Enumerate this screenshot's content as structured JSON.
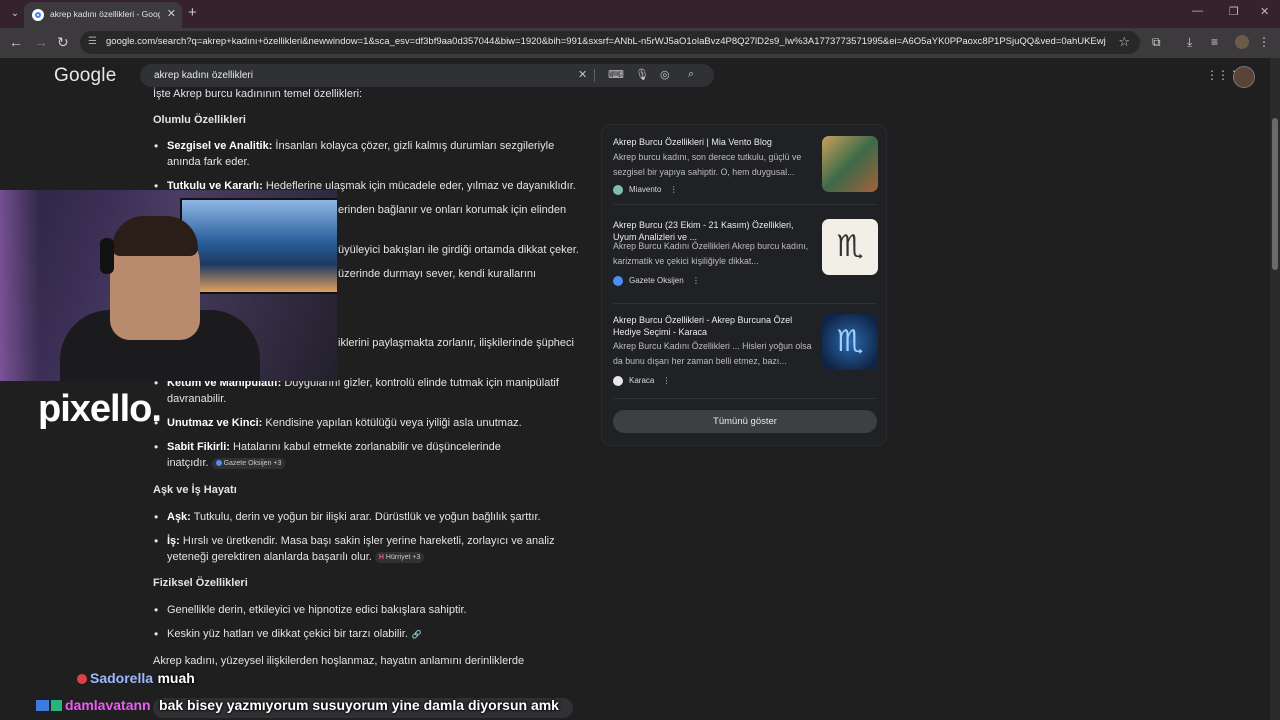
{
  "browser": {
    "tab_title": "akrep kadını özellikleri - Google",
    "url": "google.com/search?q=akrep+kadını+özellikleri&newwindow=1&sca_esv=df3bf9aa0d357044&biw=1920&bih=991&sxsrf=ANbL-n5rWJ5aO1olaBvz4P8Q27lD2s9_Iw%3A1773773571995&ei=A6O5aYK0PPaoxc8P1PSjuQQ&ved=0ahUKEwjCwa69..."
  },
  "google": {
    "logo": "Google",
    "query": "akrep kadını özellikleri"
  },
  "main": {
    "intro": "İşte Akrep burcu kadınının temel özellikleri:",
    "sections": [
      {
        "heading": "Olumlu Özellikleri",
        "items": [
          {
            "bold": "Sezgisel ve Analitik:",
            "text": " İnsanları kolayca çözer, gizli kalmış durumları sezgileriyle",
            "text2": "anında fark eder."
          },
          {
            "bold": "Tutkulu ve Kararlı:",
            "text": " Hedeflerine ulaşmak için mücadele eder, yılmaz ve dayanıklıdır."
          },
          {
            "frag1": "erinden bağlanır ve onları korumak için elinden"
          },
          {
            "frag2": "üyüleyici bakışları ile girdiği ortamda dikkat çeker."
          },
          {
            "frag3": "üzerinde durmayı sever, kendi kurallarını"
          }
        ]
      },
      {
        "heading": "",
        "items": [
          {
            "frag4": "iklerini paylaşmakta zorlanır, ilişkilerinde şüpheci"
          },
          {
            "bold": "Ketum ve Manipülatif:",
            "text": " Duygularını gizler, kontrolü elinde tutmak için manipülatif",
            "text2": "davranabilir."
          },
          {
            "bold": "Unutmaz ve Kinci:",
            "text": " Kendisine yapılan kötülüğü veya iyiliği asla unutmaz."
          },
          {
            "bold": "Sabit Fikirli:",
            "text": " Hatalarını kabul etmekte zorlanabilir ve düşüncelerinde",
            "text2": "inatçıdır.",
            "chip": "Gazete Oksijen +3"
          }
        ]
      },
      {
        "heading": "Aşk ve İş Hayatı",
        "items": [
          {
            "bold": "Aşk:",
            "text": " Tutkulu, derin ve yoğun bir ilişki arar. Dürüstlük ve yoğun bağlılık şarttır."
          },
          {
            "bold": "İş:",
            "text": " Hırslı ve üretkendir. Masa başı sakin işler yerine hareketli, zorlayıcı ve analiz",
            "text2": "yeteneği gerektiren alanlarda başarılı olur.",
            "chip": "Hürriyet +3"
          }
        ]
      },
      {
        "heading": "Fiziksel Özellikleri",
        "items": [
          {
            "text": "Genellikle derin, etkileyici ve hipnotize edici bakışlara sahiptir."
          },
          {
            "text": "Keskin yüz hatları ve dikkat çekici bir tarzı olabilir."
          }
        ]
      }
    ],
    "closing": "Akrep kadını, yüzeysel ilişkilerden hoşlanmaz, hayatın anlamını derinliklerde"
  },
  "side_panel": {
    "cards": [
      {
        "title": "Akrep Burcu Özellikleri | Mia Vento Blog",
        "snippet": "Akrep burcu kadını, son derece tutkulu, güçlü ve sezgisel bir yapıya sahiptir. O, hem duygusal...",
        "source": "Miavento",
        "thumb_color": "#6b8a5a"
      },
      {
        "title": "Akrep Burcu (23 Ekim - 21 Kasım) Özellikleri, Uyum Analizleri ve ...",
        "snippet": "Akrep Burcu Kadını Özellikleri Akrep burcu kadını, karizmatik ve çekici kişiliğiyle dikkat...",
        "source": "Gazete Oksijen",
        "thumb_color": "#f2efe6"
      },
      {
        "title": "Akrep Burcu Özellikleri - Akrep Burcuna Özel Hediye Seçimi - Karaca",
        "snippet": "Akrep Burcu Kadını Özellikleri ... Hisleri yoğun olsa da bunu dışarı her zaman belli etmez, bazı...",
        "source": "Karaca",
        "thumb_color": "#1b3a66"
      }
    ],
    "show_all": "Tümünü göster"
  },
  "overlay": {
    "brand": "pixello.",
    "chat": [
      {
        "user": "Sadorella",
        "message": "muah",
        "color": "#9fb6ff"
      },
      {
        "user": "damlavatann",
        "message": "bak bisey yazmıyorum susuyorum yine damla diyorsun amk",
        "color": "#e85cf0"
      }
    ]
  }
}
